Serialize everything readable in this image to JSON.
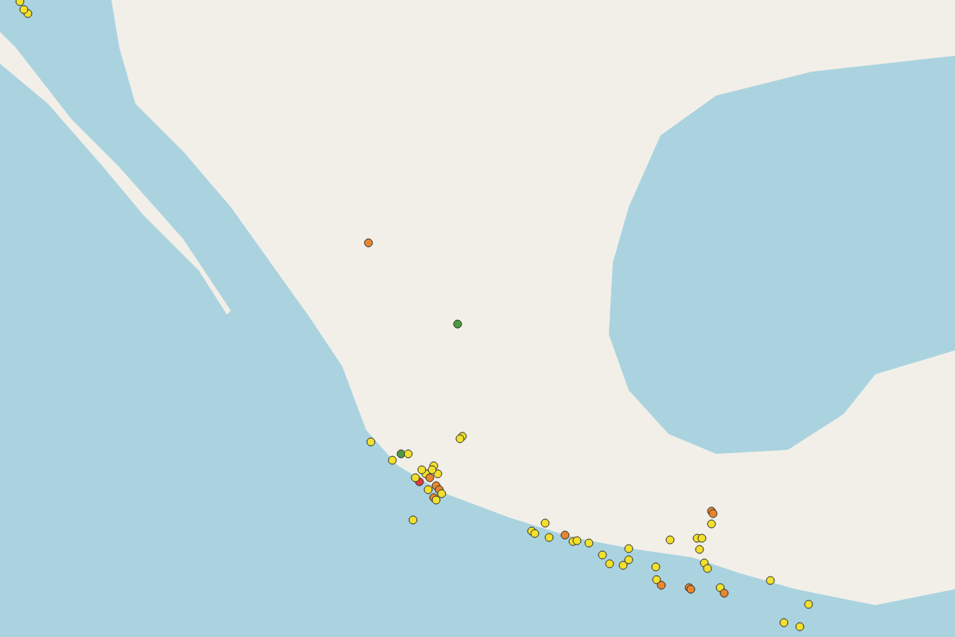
{
  "markers": [
    {
      "color": "#f2e02c"
    },
    {
      "color": "#f2e02c"
    },
    {
      "color": "#f2e02c"
    },
    {
      "color": "#e8862e"
    },
    {
      "color": "#4e9a3e"
    },
    {
      "color": "#f2e02c"
    },
    {
      "color": "#f2e02c"
    },
    {
      "color": "#4e9a3e"
    },
    {
      "color": "#f2e02c"
    },
    {
      "color": "#f2e02c"
    },
    {
      "color": "#f2e02c"
    },
    {
      "color": "#f2e02c"
    },
    {
      "color": "#e03a3a"
    },
    {
      "color": "#f2e02c"
    },
    {
      "color": "#f2e02c"
    },
    {
      "color": "#f2e02c"
    },
    {
      "color": "#e8862e"
    },
    {
      "color": "#e8862e"
    },
    {
      "color": "#e8862e"
    },
    {
      "color": "#e8862e"
    },
    {
      "color": "#f2e02c"
    },
    {
      "color": "#f2e02c"
    },
    {
      "color": "#f2e02c"
    },
    {
      "color": "#f2e02c"
    },
    {
      "color": "#f2e02c"
    },
    {
      "color": "#f2e02c"
    },
    {
      "color": "#f2e02c"
    },
    {
      "color": "#f2e02c"
    },
    {
      "color": "#f2e02c"
    },
    {
      "color": "#f2e02c"
    },
    {
      "color": "#e8862e"
    },
    {
      "color": "#f2e02c"
    },
    {
      "color": "#f2e02c"
    },
    {
      "color": "#f2e02c"
    },
    {
      "color": "#f2e02c"
    },
    {
      "color": "#f2e02c"
    },
    {
      "color": "#f2e02c"
    },
    {
      "color": "#f2e02c"
    },
    {
      "color": "#f2e02c"
    },
    {
      "color": "#f2e02c"
    },
    {
      "color": "#f2e02c"
    },
    {
      "color": "#e8862e"
    },
    {
      "color": "#f2e02c"
    },
    {
      "color": "#e8862e"
    },
    {
      "color": "#e8862e"
    },
    {
      "color": "#e8862e"
    },
    {
      "color": "#e8862e"
    },
    {
      "color": "#f2e02c"
    },
    {
      "color": "#f2e02c"
    },
    {
      "color": "#f2e02c"
    },
    {
      "color": "#f2e02c"
    },
    {
      "color": "#f2e02c"
    },
    {
      "color": "#f2e02c"
    },
    {
      "color": "#f2e02c"
    },
    {
      "color": "#e8862e"
    },
    {
      "color": "#f2e02c"
    },
    {
      "color": "#f2e02c"
    },
    {
      "color": "#f2e02c"
    },
    {
      "color": "#f2e02c"
    }
  ]
}
